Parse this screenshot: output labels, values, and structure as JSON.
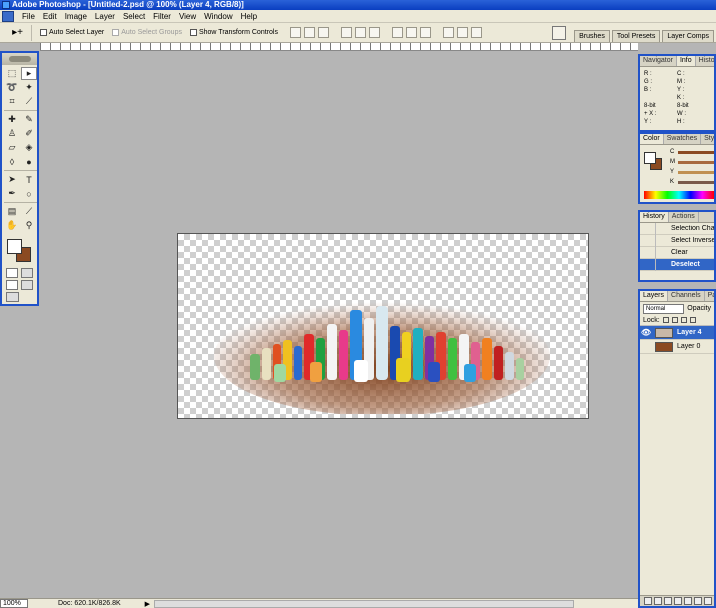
{
  "window": {
    "title": "Adobe Photoshop - [Untitled-2.psd @ 100% (Layer 4, RGB/8)]"
  },
  "menu": [
    "File",
    "Edit",
    "Image",
    "Layer",
    "Select",
    "Filter",
    "View",
    "Window",
    "Help"
  ],
  "options": {
    "tool_glyph": "▸+",
    "auto_select_layer": "Auto Select Layer",
    "auto_select_groups": "Auto Select Groups",
    "show_transform_controls": "Show Transform Controls"
  },
  "palette_well": [
    "Brushes",
    "Tool Presets",
    "Layer Comps"
  ],
  "navigator_panel": {
    "tabs": [
      "Navigator",
      "Info",
      "Histo"
    ],
    "active_tab": "Info",
    "rows": [
      [
        "R :",
        "C :"
      ],
      [
        "G :",
        "M :"
      ],
      [
        "B :",
        "Y :"
      ],
      [
        "",
        "K :"
      ],
      [
        "8-bit",
        "8-bit"
      ],
      [
        "",
        ""
      ],
      [
        "+ X :",
        "W :"
      ],
      [
        "  Y :",
        "H :"
      ]
    ]
  },
  "color_panel": {
    "tabs": [
      "Color",
      "Swatches",
      "Styles"
    ],
    "active_tab": "Color",
    "channels": [
      {
        "label": "C",
        "color": "#8b4a22"
      },
      {
        "label": "M",
        "color": "#a86a3e"
      },
      {
        "label": "Y",
        "color": "#c09050"
      },
      {
        "label": "K",
        "color": "#7a5a4a"
      }
    ],
    "foreground_color": "#ffffff",
    "background_color": "#8b4a22"
  },
  "history_panel": {
    "tabs": [
      "History",
      "Actions"
    ],
    "active_tab": "History",
    "items": [
      "Selection Change",
      "Select Inverse",
      "Clear",
      "Deselect"
    ],
    "current_index": 3
  },
  "layers_panel": {
    "tabs": [
      "Layers",
      "Channels",
      "Paths"
    ],
    "active_tab": "Layers",
    "blend_mode": "Normal",
    "opacity_label": "Opacity",
    "lock_label": "Lock:",
    "layers": [
      {
        "name": "Layer 4",
        "visible": true,
        "selected": true,
        "thumb_color": "#c8b8a8"
      },
      {
        "name": "Layer 0",
        "visible": false,
        "selected": false,
        "thumb_color": "#8b4a22"
      }
    ]
  },
  "status": {
    "zoom": "100%",
    "doc_info": "Doc: 620.1K/826.8K"
  }
}
